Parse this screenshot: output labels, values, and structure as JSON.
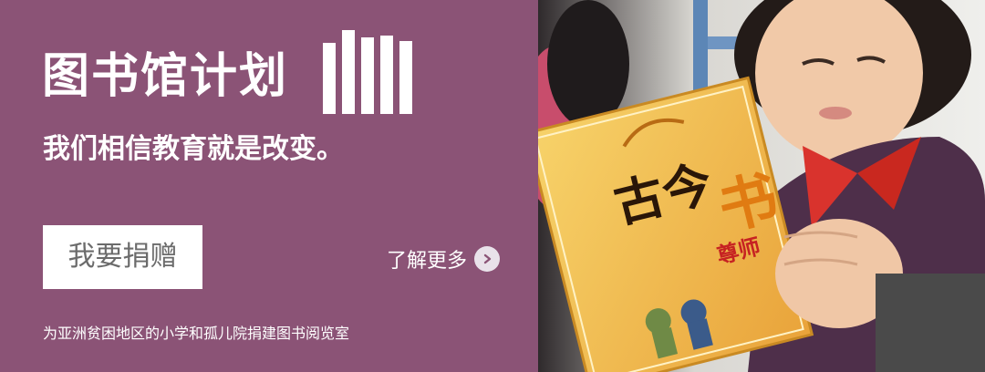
{
  "banner": {
    "title": "图书馆计划",
    "slogan": "我们相信教育就是改变。",
    "donate_label": "我要捐赠",
    "learn_more_label": "了解更多",
    "footer": "为亚洲贫困地区的小学和孤儿院捐建图书阅览室",
    "logo_icon": "bookshelf-icon",
    "arrow_icon": "chevron-right-icon",
    "colors": {
      "panel": "#8b5376",
      "button_bg": "#ffffff",
      "button_text": "#6b6b6b"
    }
  },
  "photo": {
    "book_title": "古今",
    "book_badge_1": "书",
    "book_badge_2": "尊师"
  }
}
